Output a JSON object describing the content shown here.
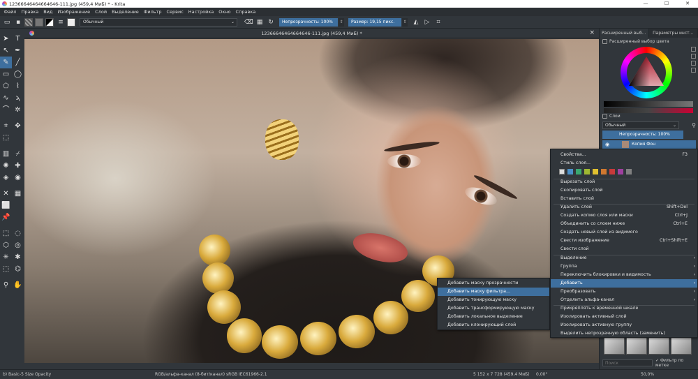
{
  "window": {
    "title": "12366646464664646-111.jpg (459,4 МиБ) * - Krita",
    "controls": [
      "—",
      "☐",
      "✕"
    ]
  },
  "menubar": [
    "Файл",
    "Правка",
    "Вид",
    "Изображение",
    "Слой",
    "Выделение",
    "Фильтр",
    "Сервис",
    "Настройка",
    "Окно",
    "Справка"
  ],
  "toolbar": {
    "blend_mode": "Обычный",
    "opacity": "Непрозрачность: 100%",
    "size": "Размер: 19,15 пикс."
  },
  "document_tab": {
    "label": "12366646464664646-111.jpg (459,4 МиБ) *"
  },
  "docker": {
    "tabs": [
      "Расширенный выб...",
      "Параметры инст..."
    ],
    "color_title": "Расширенный выбор цвета",
    "layers_title": "Слои",
    "layers_blend": "Обычный",
    "layers_opacity": "Непрозрачность: 100%",
    "layer_name": "Копия Фон",
    "search_placeholder": "Поиск",
    "filter_label": "Фильтр по метке"
  },
  "colors": {
    "accent": "#3e6f9e",
    "label_swatches": [
      "#4a90c8",
      "#3aa870",
      "#a0b832",
      "#e0c030",
      "#d07830",
      "#c83a3a",
      "#a040a0",
      "#808080"
    ]
  },
  "context_menu": {
    "items": [
      {
        "label": "Свойства...",
        "shortcut": "F3"
      },
      {
        "label": "Стиль слоя..."
      },
      {
        "label": "Вырезать слой"
      },
      {
        "label": "Скопировать слой"
      },
      {
        "label": "Вставить слой"
      },
      {
        "label": "Удалить слой",
        "shortcut": "Shift+Del"
      },
      {
        "label": "Создать копию слоя или маски",
        "shortcut": "Ctrl+J"
      },
      {
        "label": "Объединить со слоем ниже",
        "shortcut": "Ctrl+E"
      },
      {
        "label": "Создать новый слой из видимого"
      },
      {
        "label": "Свести изображение",
        "shortcut": "Ctrl+Shift+E"
      },
      {
        "label": "Свести слой"
      },
      {
        "label": "Выделение"
      },
      {
        "label": "Группа"
      },
      {
        "label": "Переключить блокировки и видимость"
      },
      {
        "label": "Добавить"
      },
      {
        "label": "Преобразовать"
      },
      {
        "label": "Отделить альфа-канал"
      },
      {
        "label": "Прикреплять к временной шкале"
      },
      {
        "label": "Изолировать активный слой"
      },
      {
        "label": "Изолировать активную группу"
      },
      {
        "label": "Выделить непрозрачную область (заменить)"
      }
    ]
  },
  "submenu": {
    "items": [
      "Добавить маску прозрачности",
      "Добавить маску фильтра...",
      "Добавить тонирующую маску",
      "Добавить трансформирующую маску",
      "Добавить локальное выделение",
      "Добавить клонирующий слой"
    ]
  },
  "statusbar": {
    "brush": "b) Basic-5 Size Opacity",
    "color_model": "RGB/альфа-канал (8-бит/канал)  sRGB IEC61966-2.1",
    "dimensions": "5 152 x 7 728 (459,4 МиБ)",
    "rotation": "0,00°",
    "zoom": "50,0%"
  }
}
